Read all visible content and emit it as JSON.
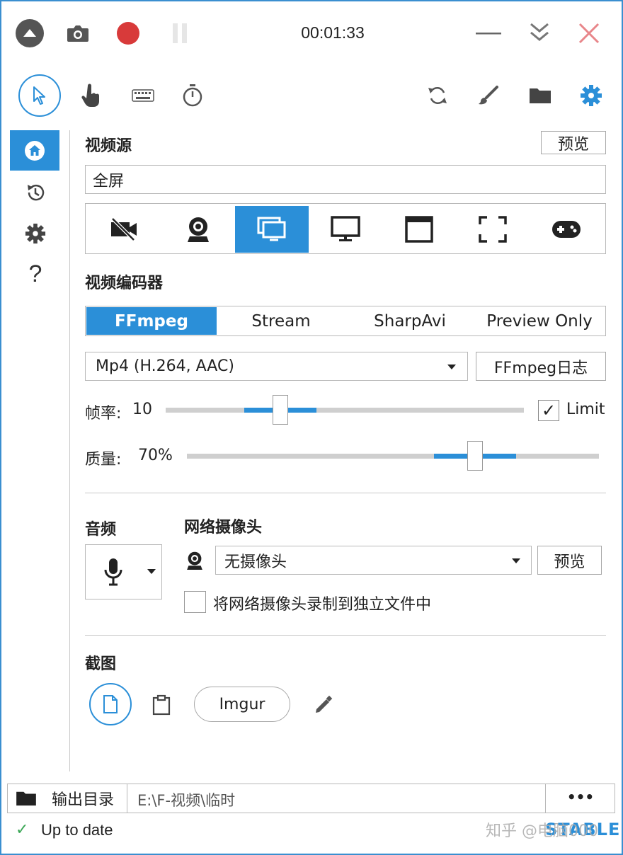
{
  "titlebar": {
    "timer": "00:01:33",
    "icons": [
      "collapse-up-icon",
      "camera-icon",
      "record-icon",
      "pause-icon",
      "minimize-icon",
      "minimize-to-tray-icon",
      "close-icon"
    ]
  },
  "toolbar": {
    "left_icons": [
      "mouse-pointer-icon",
      "click-hand-icon",
      "keyboard-icon",
      "timer-icon"
    ],
    "right_icons": [
      "refresh-icon",
      "brush-icon",
      "folder-icon",
      "settings-icon"
    ]
  },
  "sidebar": {
    "items": [
      "home-icon",
      "history-icon",
      "settings-icon",
      "help-icon"
    ],
    "help_glyph": "?"
  },
  "video_source": {
    "label": "视频源",
    "preview_label": "预览",
    "value": "全屏",
    "source_types": [
      "no-video-icon",
      "webcam-icon",
      "screen-icon",
      "window-icon",
      "region-icon",
      "fullscreen-icon",
      "game-icon"
    ],
    "selected_index": 2
  },
  "video_encoder": {
    "label": "视频编码器",
    "tabs": [
      "FFmpeg",
      "Stream",
      "SharpAvi",
      "Preview Only"
    ],
    "selected_tab": 0,
    "format_value": "Mp4 (H.264, AAC)",
    "log_button": "FFmpeg日志"
  },
  "framerate": {
    "label": "帧率:",
    "value": "10",
    "limit_label": "Limit",
    "limit_checked": true,
    "check_glyph": "✓",
    "level_fraction": 0.32
  },
  "quality": {
    "label": "质量:",
    "value": "70%",
    "level_fraction": 0.7
  },
  "audio": {
    "label": "音频"
  },
  "webcam": {
    "label": "网络摄像头",
    "selected": "无摄像头",
    "preview_label": "预览",
    "separate_file_label": "将网络摄像头录制到独立文件中",
    "separate_file_checked": false
  },
  "screenshot": {
    "label": "截图",
    "imgur_label": "Imgur"
  },
  "output": {
    "label": "输出目录",
    "path": "E:\\F-视频\\临时",
    "more_glyph": "•••"
  },
  "status": {
    "text": "Up to date",
    "check_glyph": "✓",
    "version_tag": "STABLE",
    "watermark": "知乎 @电脑000"
  },
  "colors": {
    "accent": "#2b8fd8",
    "record": "#d83a3a",
    "close": "#e8868a",
    "status_ok": "#3aa655"
  }
}
